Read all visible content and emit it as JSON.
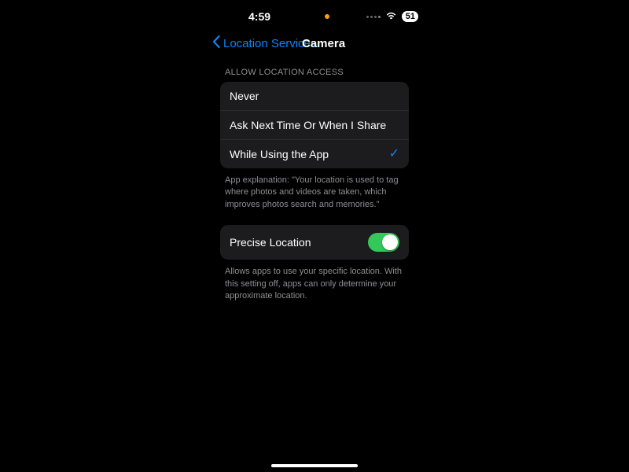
{
  "status": {
    "time": "4:59",
    "battery_level": "51"
  },
  "nav": {
    "back_label": "Location Services",
    "title": "Camera"
  },
  "access": {
    "header": "ALLOW LOCATION ACCESS",
    "options": [
      {
        "label": "Never",
        "selected": false
      },
      {
        "label": "Ask Next Time Or When I Share",
        "selected": false
      },
      {
        "label": "While Using the App",
        "selected": true
      }
    ],
    "footer": "App explanation: \"Your location is used to tag where photos and videos are taken, which improves photos search and memories.\""
  },
  "precise": {
    "label": "Precise Location",
    "enabled": true,
    "footer": "Allows apps to use your specific location. With this setting off, apps can only determine your approximate location."
  }
}
